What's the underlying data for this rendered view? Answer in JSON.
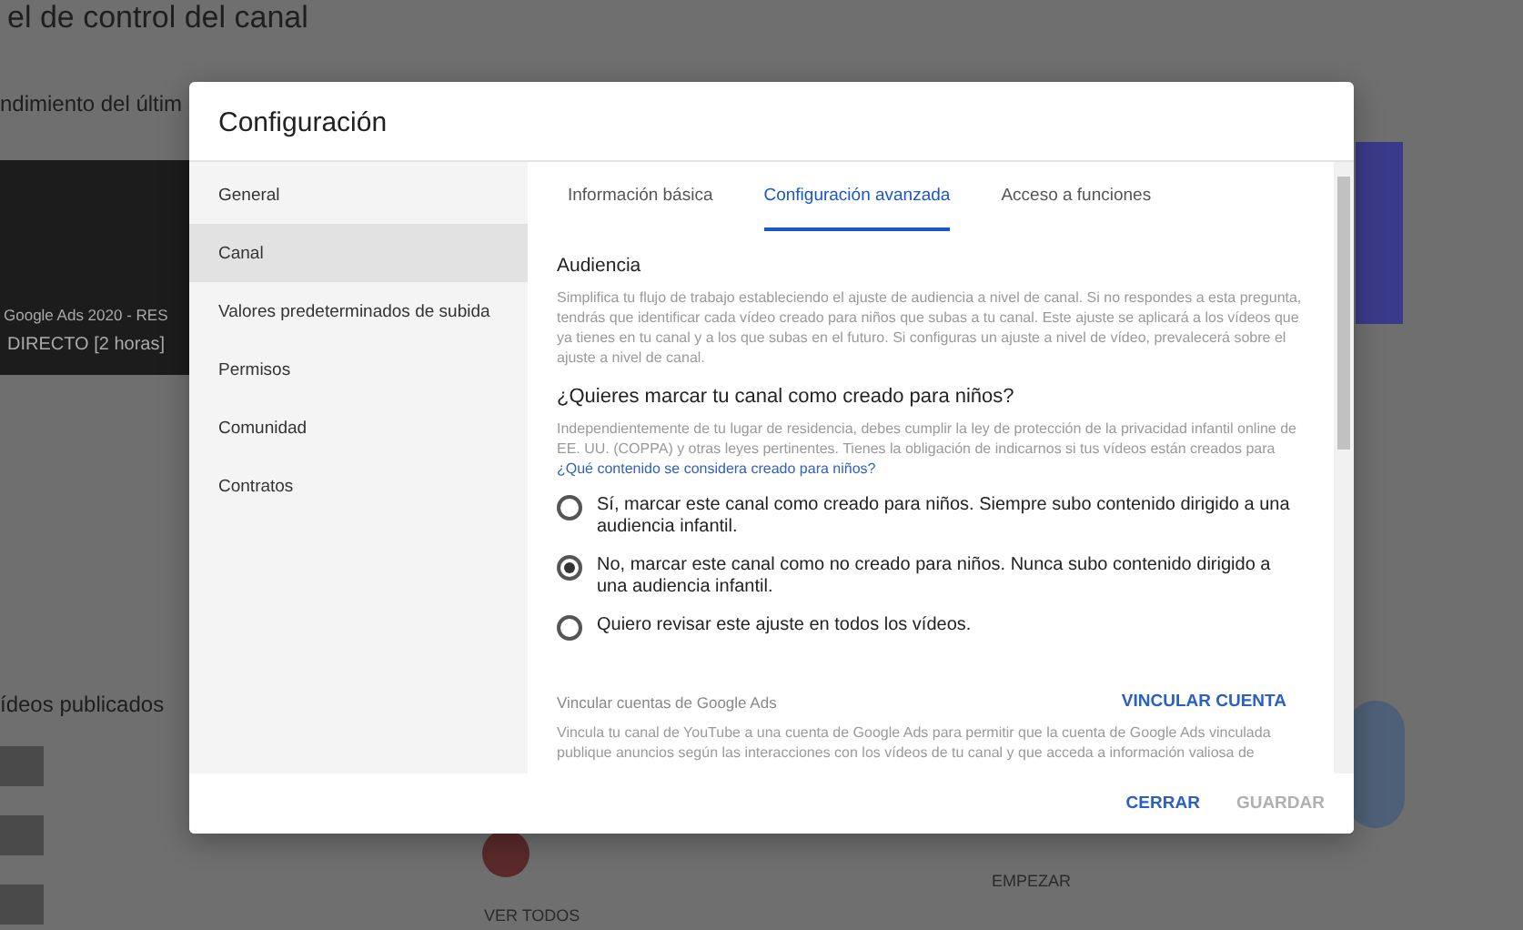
{
  "page": {
    "title": "el de control del canal",
    "section_title": "ndimiento del últim",
    "video_title": "Google Ads 2020 - RES",
    "video_subtitle": "DIRECTO [2 horas]",
    "published_title": "ídeos publicados",
    "see_all": "VER TODOS",
    "start": "EMPEZAR"
  },
  "dialog": {
    "title": "Configuración",
    "nav": [
      {
        "label": "General",
        "selected": false
      },
      {
        "label": "Canal",
        "selected": true
      },
      {
        "label": "Valores predeterminados de subida",
        "selected": false
      },
      {
        "label": "Permisos",
        "selected": false
      },
      {
        "label": "Comunidad",
        "selected": false
      },
      {
        "label": "Contratos",
        "selected": false
      }
    ],
    "tabs": [
      {
        "label": "Información básica",
        "selected": false
      },
      {
        "label": "Configuración avanzada",
        "selected": true
      },
      {
        "label": "Acceso a funciones",
        "selected": false
      }
    ],
    "audience": {
      "heading": "Audiencia",
      "description": "Simplifica tu flujo de trabajo estableciendo el ajuste de audiencia a nivel de canal. Si no respondes a esta pregunta, tendrás que identificar cada vídeo creado para niños que subas a tu canal. Este ajuste se aplicará a los vídeos que ya tienes en tu canal y a los que subas en el futuro. Si configuras un ajuste a nivel de vídeo, prevalecerá sobre el ajuste a nivel de canal."
    },
    "kids": {
      "question": "¿Quieres marcar tu canal como creado para niños?",
      "description": "Independientemente de tu lugar de residencia, debes cumplir la ley de protección de la privacidad infantil online de EE. UU. (COPPA) y otras leyes pertinentes. Tienes la obligación de indicarnos si tus vídeos están creados para",
      "link": "¿Qué contenido se considera creado para niños?",
      "options": [
        {
          "label": "Sí, marcar este canal como creado para niños. Siempre subo contenido dirigido a una audiencia infantil.",
          "selected": false
        },
        {
          "label": "No, marcar este canal como no creado para niños. Nunca subo contenido dirigido a una audiencia infantil.",
          "selected": true
        },
        {
          "label": "Quiero revisar este ajuste en todos los vídeos.",
          "selected": false
        }
      ]
    },
    "ads": {
      "heading": "Vincular cuentas de Google Ads",
      "action": "VINCULAR CUENTA",
      "description": "Vincula tu canal de YouTube a una cuenta de Google Ads para permitir que la cuenta de Google Ads vinculada publique anuncios según las interacciones con los vídeos de tu canal y que acceda a información valiosa de"
    },
    "buttons": [
      {
        "label": "CERRAR",
        "disabled": false
      },
      {
        "label": "GUARDAR",
        "disabled": true
      }
    ]
  }
}
